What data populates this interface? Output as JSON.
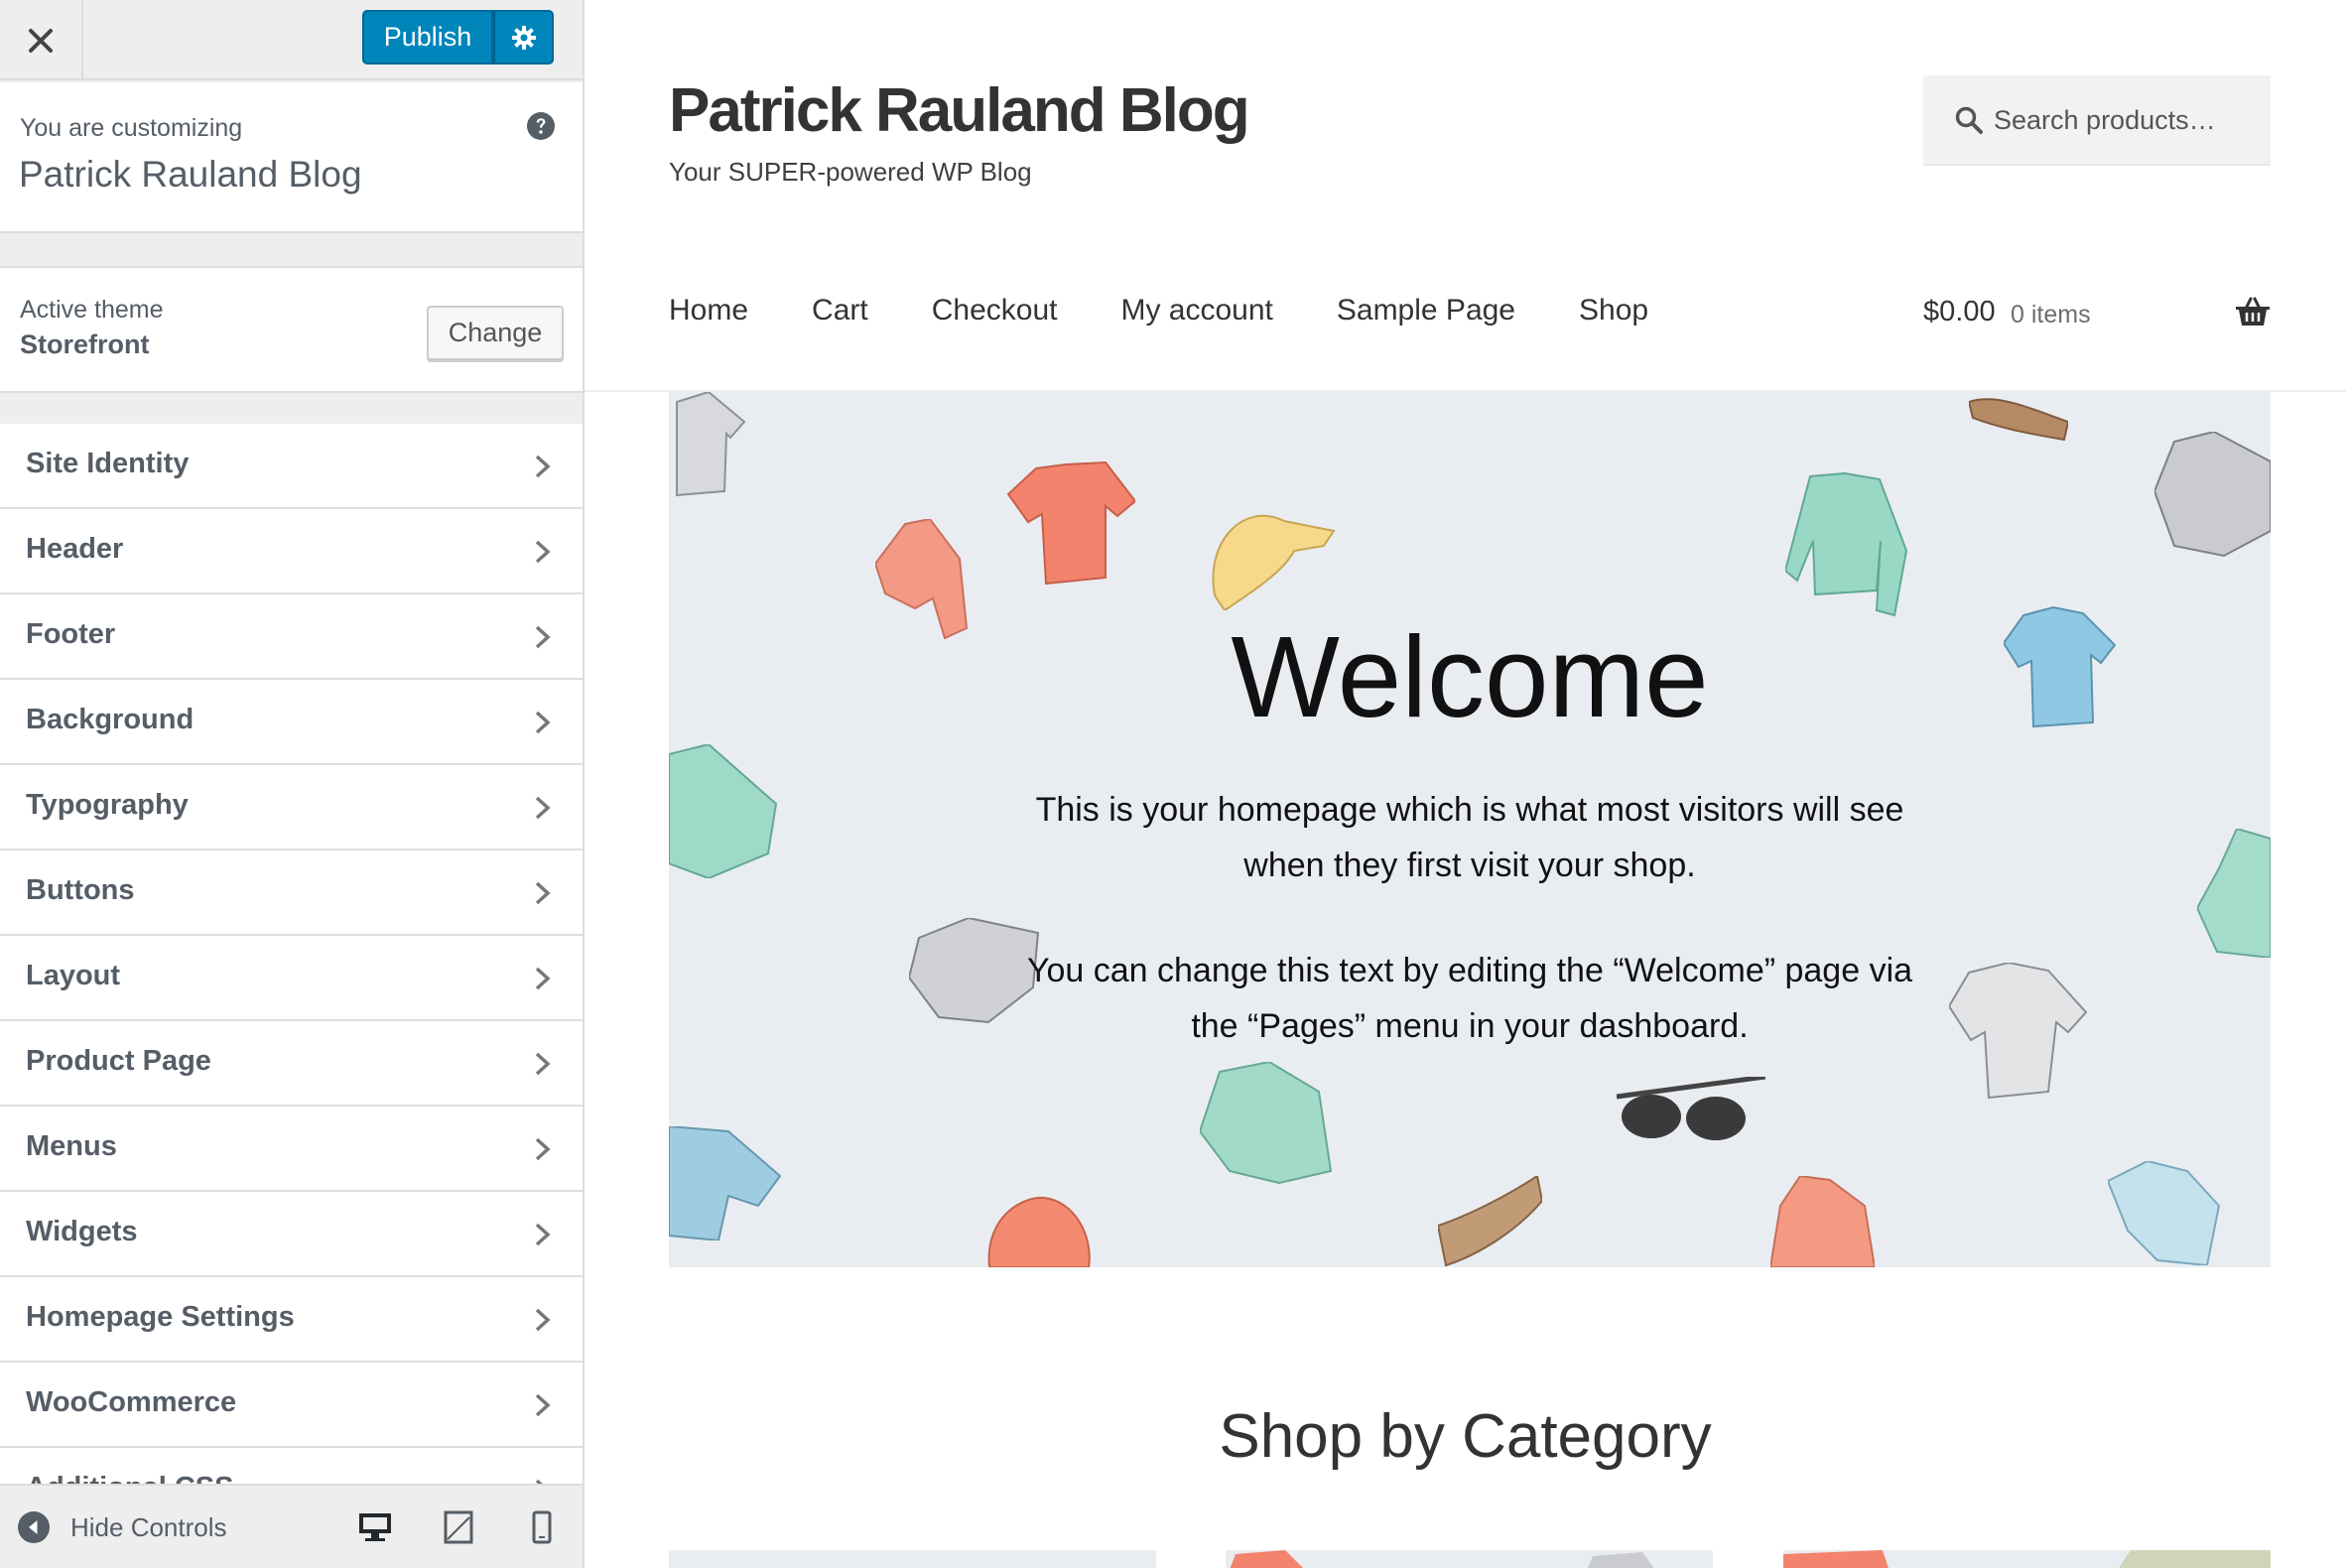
{
  "customizer": {
    "publish_label": "Publish",
    "info": {
      "label": "You are customizing",
      "site_name": "Patrick Rauland Blog"
    },
    "theme": {
      "label": "Active theme",
      "name": "Storefront",
      "change_label": "Change"
    },
    "sections": [
      {
        "label": "Site Identity"
      },
      {
        "label": "Header"
      },
      {
        "label": "Footer"
      },
      {
        "label": "Background"
      },
      {
        "label": "Typography"
      },
      {
        "label": "Buttons"
      },
      {
        "label": "Layout"
      },
      {
        "label": "Product Page"
      },
      {
        "label": "Menus"
      },
      {
        "label": "Widgets"
      },
      {
        "label": "Homepage Settings"
      },
      {
        "label": "WooCommerce"
      },
      {
        "label": "Additional CSS"
      }
    ],
    "hide_controls_label": "Hide Controls",
    "accent_color": "#0085ba"
  },
  "site": {
    "title": "Patrick Rauland Blog",
    "tagline": "Your SUPER-powered WP Blog",
    "search_placeholder": "Search products…",
    "nav": [
      {
        "label": "Home"
      },
      {
        "label": "Cart"
      },
      {
        "label": "Checkout"
      },
      {
        "label": "My account"
      },
      {
        "label": "Sample Page"
      },
      {
        "label": "Shop"
      }
    ],
    "cart": {
      "amount": "$0.00",
      "count": "0 items"
    },
    "hero": {
      "title": "Welcome",
      "paragraph1": "This is your homepage which is what most visitors will see when they first visit your shop.",
      "paragraph2": "You can change this text by editing the “Welcome” page via the “Pages” menu in your dashboard."
    },
    "shop_heading": "Shop by Category"
  }
}
